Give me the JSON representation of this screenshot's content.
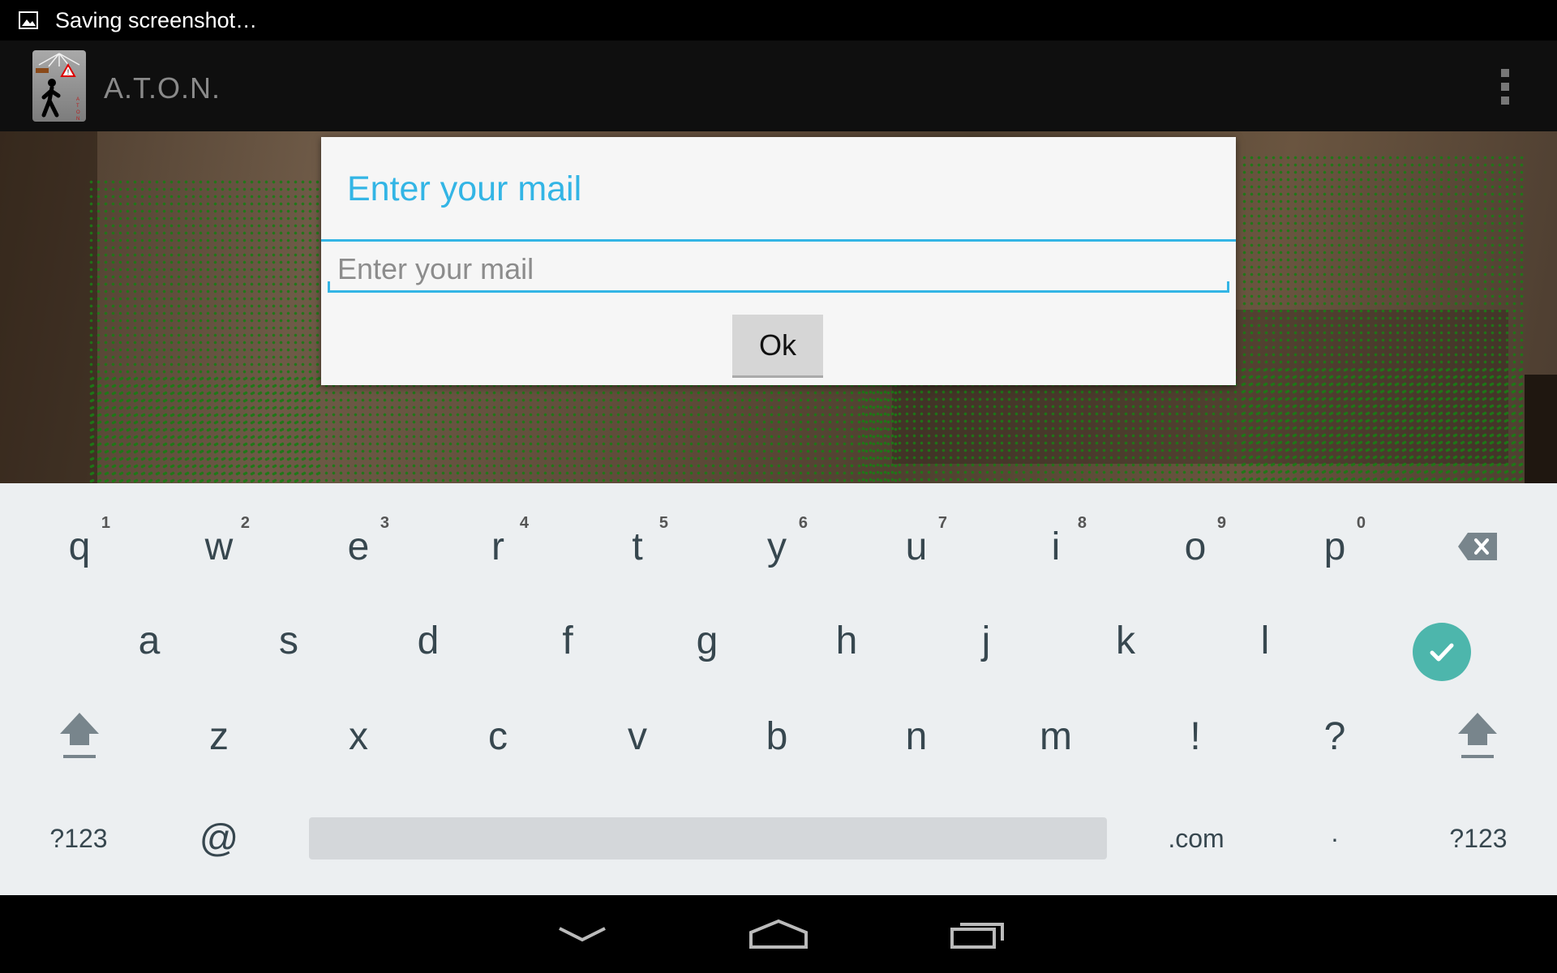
{
  "status_bar": {
    "text": "Saving screenshot…",
    "icon": "image-icon"
  },
  "app": {
    "title": "A.T.O.N.",
    "icon": "pedestrian-warning-icon"
  },
  "dialog": {
    "title": "Enter your mail",
    "input_placeholder": "Enter your mail",
    "input_value": "",
    "ok_label": "Ok",
    "accent_color": "#33b5e5"
  },
  "keyboard": {
    "row1": [
      {
        "key": "q",
        "hint": "1"
      },
      {
        "key": "w",
        "hint": "2"
      },
      {
        "key": "e",
        "hint": "3"
      },
      {
        "key": "r",
        "hint": "4"
      },
      {
        "key": "t",
        "hint": "5"
      },
      {
        "key": "y",
        "hint": "6"
      },
      {
        "key": "u",
        "hint": "7"
      },
      {
        "key": "i",
        "hint": "8"
      },
      {
        "key": "o",
        "hint": "9"
      },
      {
        "key": "p",
        "hint": "0"
      }
    ],
    "row2": [
      "a",
      "s",
      "d",
      "f",
      "g",
      "h",
      "j",
      "k",
      "l"
    ],
    "row3": [
      "z",
      "x",
      "c",
      "v",
      "b",
      "n",
      "m",
      "!",
      "?"
    ],
    "row4": {
      "symbols_left": "?123",
      "at": "@",
      "dotcom": ".com",
      "period": "·",
      "symbols_right": "?123"
    },
    "enter_color": "#4db6ac"
  },
  "nav_bar": {
    "back": "back-icon",
    "home": "home-icon",
    "recents": "recents-icon"
  }
}
